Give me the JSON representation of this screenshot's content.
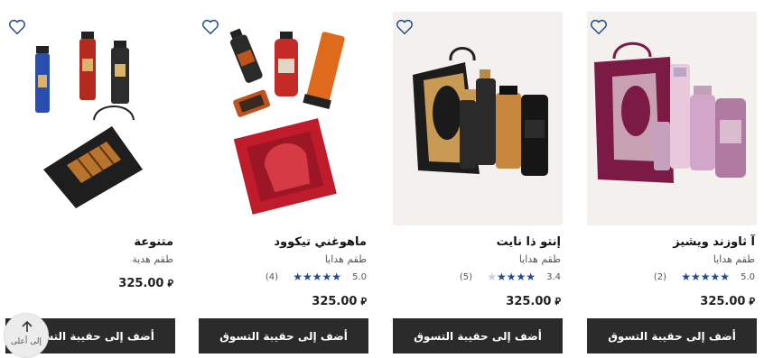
{
  "products": [
    {
      "name": "آ ثاوزند ويشيز",
      "subtitle": "طقم هدايا",
      "rating": "5.0",
      "stars": 5,
      "reviews": "(2)",
      "price": "325.00",
      "currency": "⃁",
      "button": "أضف إلى حقيبة التسوق"
    },
    {
      "name": "إنتو ذا نايت",
      "subtitle": "طقم هدايا",
      "rating": "3.4",
      "stars": 3.4,
      "reviews": "(5)",
      "price": "325.00",
      "currency": "⃁",
      "button": "أضف إلى حقيبة التسوق"
    },
    {
      "name": "ماهوغني تيكوود",
      "subtitle": "طقم هدايا",
      "rating": "5.0",
      "stars": 5,
      "reviews": "(4)",
      "price": "325.00",
      "currency": "⃁",
      "button": "أضف إلى حقيبة التسوق"
    },
    {
      "name": "متنوعة",
      "subtitle": "طقم هدية",
      "price": "325.00",
      "currency": "⃁",
      "button": "أضف إلى حقيبة التسوق"
    }
  ],
  "back_to_top": {
    "label": "إلى أعلى",
    "icon": "arrow-up-icon"
  },
  "icons": {
    "wishlist": "heart-outline-icon"
  },
  "colors": {
    "accent": "#1f4a8c",
    "button_bg": "#2b2b2b",
    "image_bg": "#f3f0ee"
  }
}
